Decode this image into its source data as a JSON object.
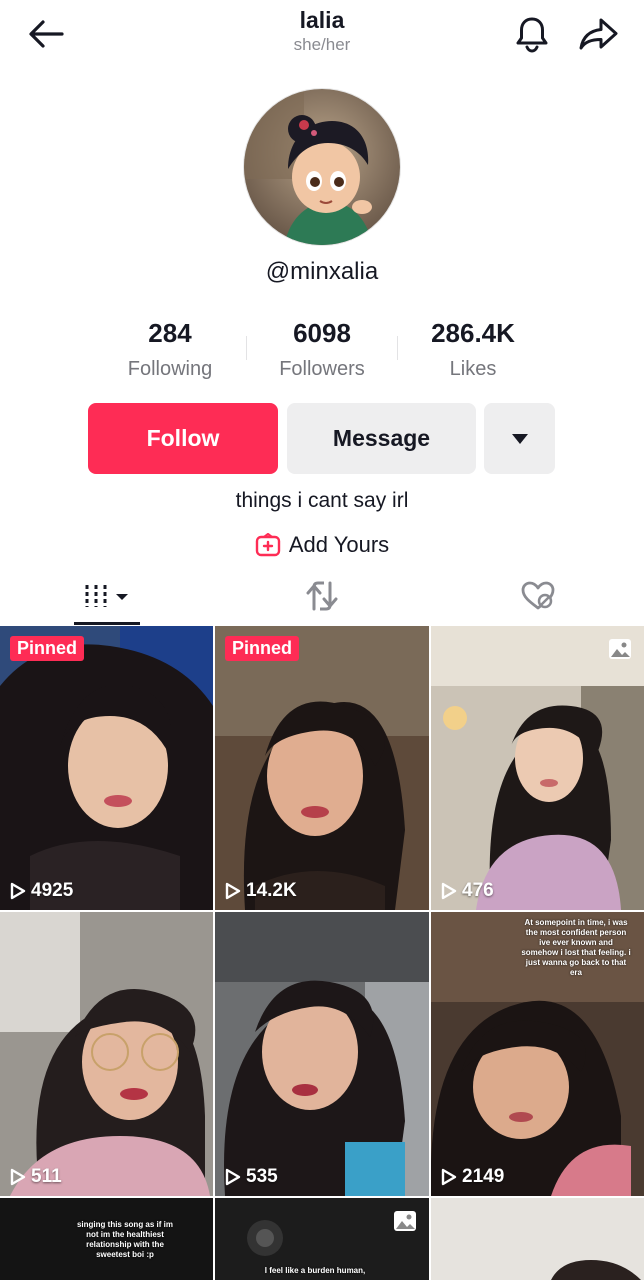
{
  "header": {
    "name": "lalia",
    "pronouns": "she/her",
    "icons": [
      "back-arrow-icon",
      "bell-icon",
      "share-icon"
    ]
  },
  "profile": {
    "handle": "@minxalia",
    "bio": "things i cant say irl",
    "add_yours": "Add Yours"
  },
  "stats": [
    {
      "value": "284",
      "label": "Following"
    },
    {
      "value": "6098",
      "label": "Followers"
    },
    {
      "value": "286.4K",
      "label": "Likes"
    }
  ],
  "actions": {
    "follow": "Follow",
    "message": "Message"
  },
  "colors": {
    "accent": "#fe2c55",
    "secondary_button": "#eeeeef"
  },
  "grid": [
    {
      "pinned": "Pinned",
      "views": "4925",
      "caption": ""
    },
    {
      "pinned": "Pinned",
      "views": "14.2K",
      "caption": ""
    },
    {
      "pinned": "",
      "views": "476",
      "caption": "",
      "photo": true
    },
    {
      "pinned": "",
      "views": "511",
      "caption": ""
    },
    {
      "pinned": "",
      "views": "535",
      "caption": ""
    },
    {
      "pinned": "",
      "views": "2149",
      "caption": "At somepoint in time, i was the most confident person ive ever known and somehow i lost that feeling. i just wanna go back to that era"
    },
    {
      "pinned": "",
      "views": "",
      "caption": "singing this song as if im not im the healthiest relationship with the sweetest boi :p"
    },
    {
      "pinned": "",
      "views": "",
      "caption": "I feel like a burden human,",
      "photo": true
    },
    {
      "pinned": "",
      "views": "",
      "caption": ""
    }
  ]
}
